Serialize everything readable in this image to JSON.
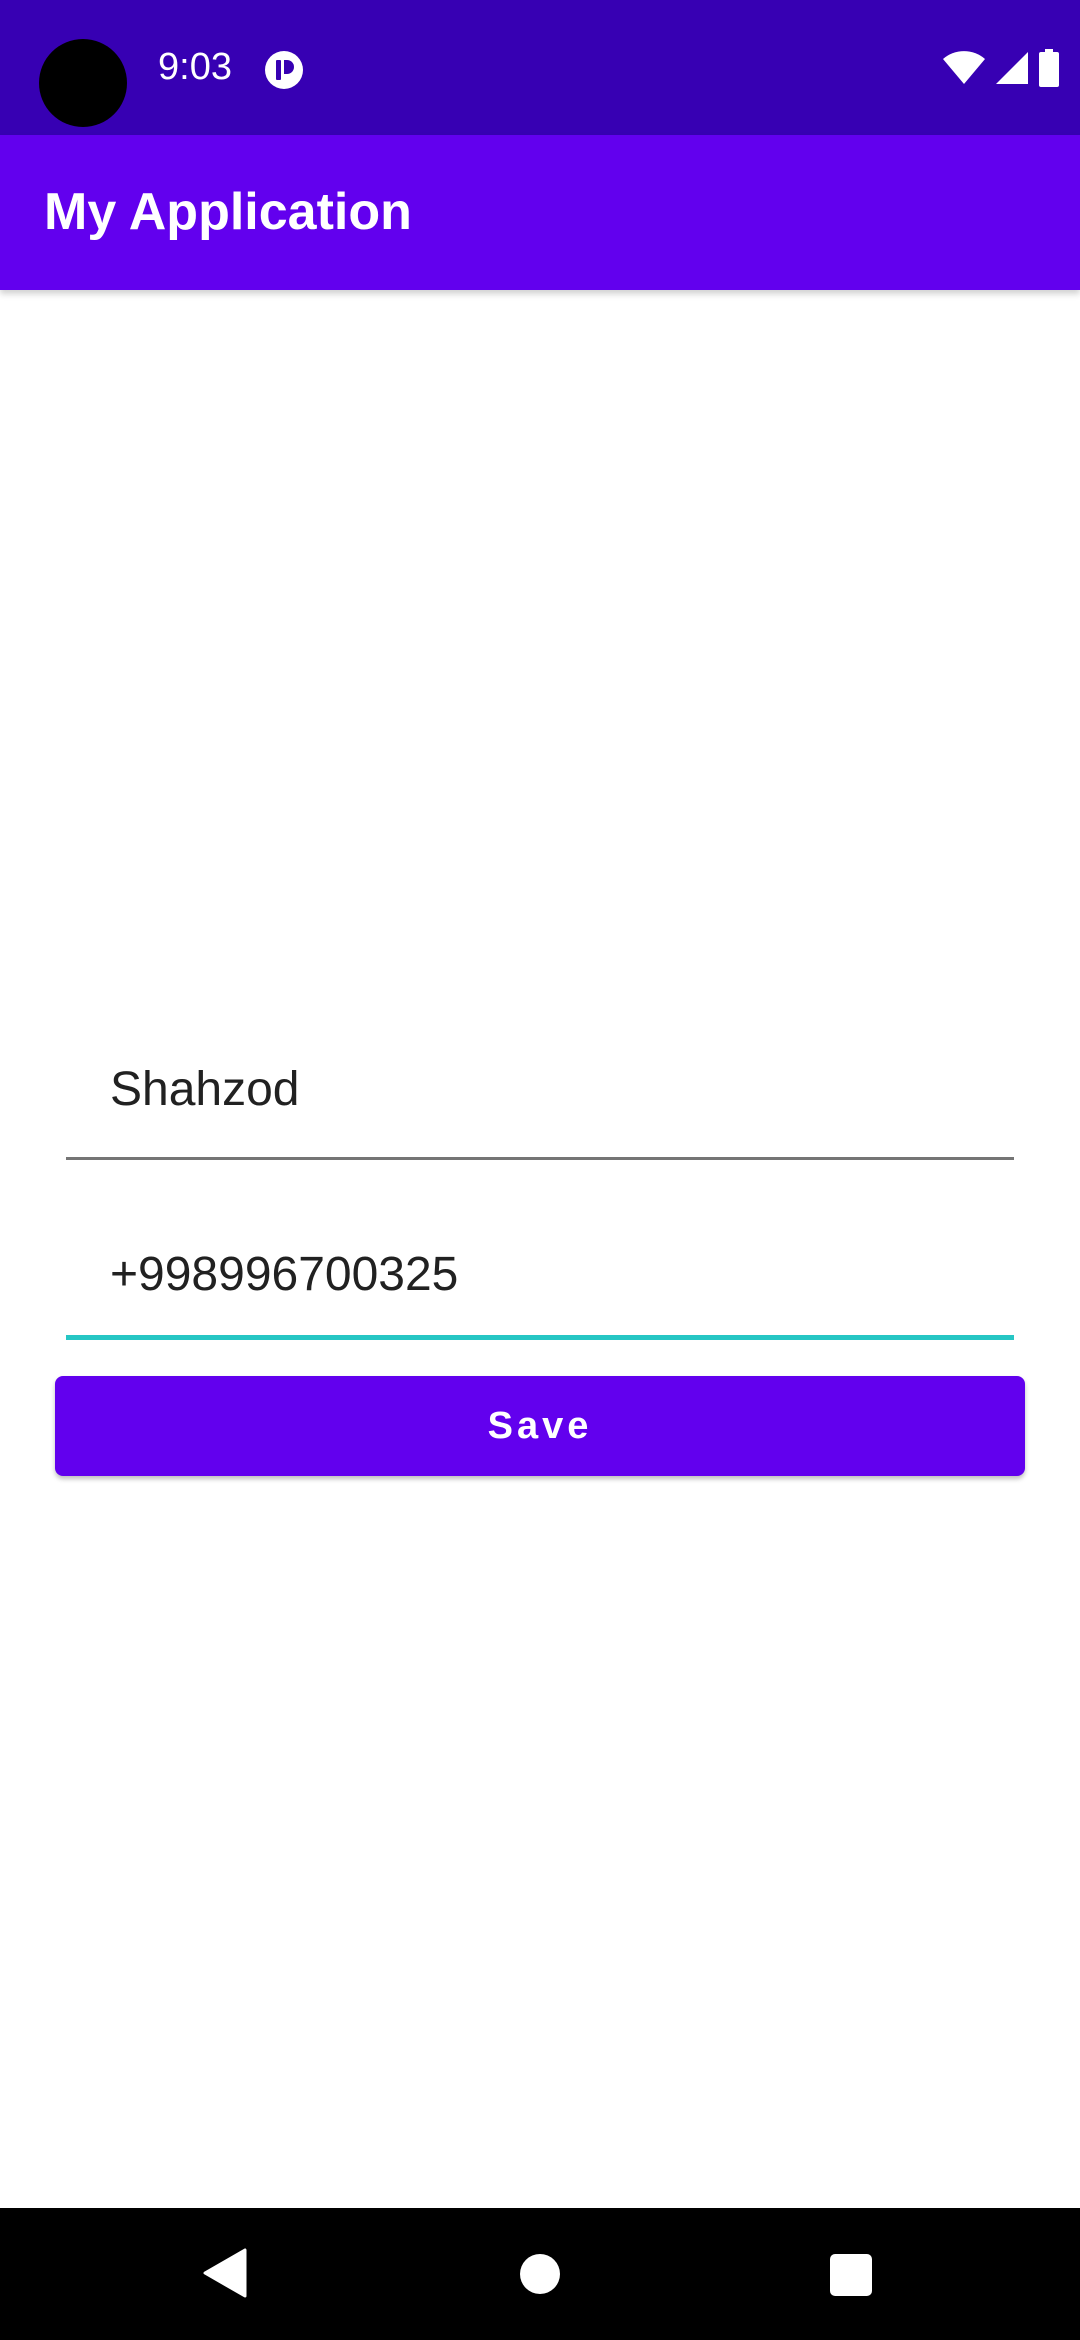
{
  "status_bar": {
    "time": "9:03",
    "icons": [
      "app-notification-icon",
      "wifi-icon",
      "cellular-signal-icon",
      "battery-icon"
    ]
  },
  "app_bar": {
    "title": "My Application",
    "color": "#6200EE"
  },
  "form": {
    "name_field": {
      "value": "Shahzod"
    },
    "phone_field": {
      "value": "+998996700325",
      "focused": true
    },
    "save_button_label": "Save"
  },
  "nav_bar": {
    "icons": [
      "back-icon",
      "home-icon",
      "recents-icon"
    ]
  },
  "colors": {
    "status_bar": "#3700B3",
    "primary": "#6200EE",
    "focus_underline": "#26C6C4"
  }
}
